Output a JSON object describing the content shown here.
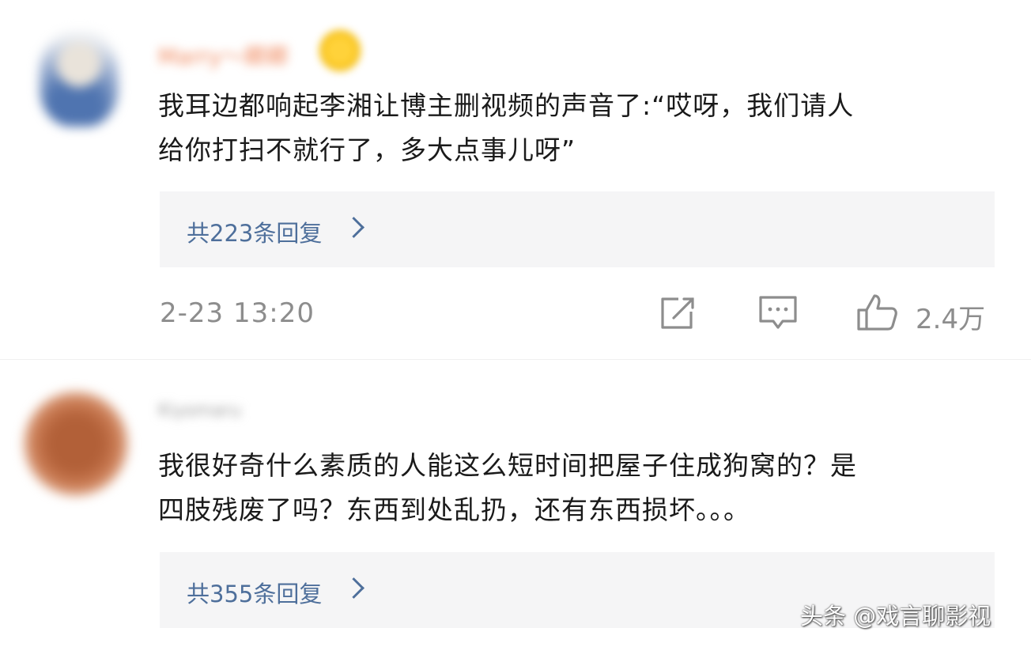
{
  "comments": [
    {
      "username": "Marry～卿卿",
      "text_line1": "我耳边都响起李湘让博主删视频的声音了:“哎呀，我们请人",
      "text_line2": "给你打扫不就行了，多大点事儿呀”",
      "replies_label": "共223条回复",
      "timestamp": "2-23 13:20",
      "likes": "2.4万"
    },
    {
      "username": "Kiyomaru",
      "text_line1": "我很好奇什么素质的人能这么短时间把屋子住成狗窝的？是",
      "text_line2": "四肢残废了吗？东西到处乱扔，还有东西损坏。。。",
      "replies_label": "共355条回复"
    }
  ],
  "watermark": "头条 @戏言聊影视",
  "icons": {
    "share": "share-icon",
    "comment": "comment-icon",
    "like": "thumbs-up-icon",
    "reply_arrow": "chevron-right-icon"
  },
  "colors": {
    "link": "#4e6f9b",
    "meta": "#8d8d8d",
    "reply_bg": "#f5f5f6"
  }
}
